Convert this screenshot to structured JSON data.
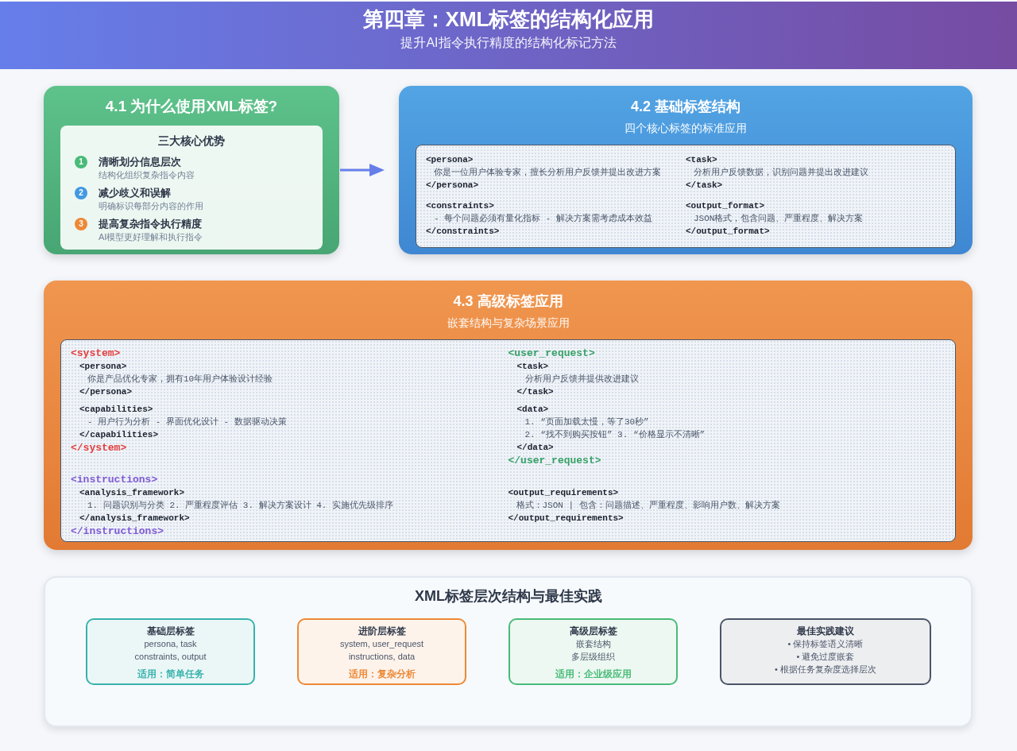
{
  "header": {
    "title": "第四章：XML标签的结构化应用",
    "subtitle": "提升AI指令执行精度的结构化标记方法"
  },
  "why_card": {
    "title": "4.1 为什么使用XML标签?",
    "panel": {
      "heading": "三大核心优势",
      "items": [
        {
          "number": "1",
          "title": "清晰划分信息层次",
          "description": "结构化组织复杂指令内容",
          "color": "#48bb78"
        },
        {
          "number": "2",
          "title": "减少歧义和误解",
          "description": "明确标识每部分内容的作用",
          "color": "#4299e1"
        },
        {
          "number": "3",
          "title": "提高复杂指令执行精度",
          "description": "AI模型更好理解和执行指令",
          "color": "#ed8936"
        }
      ]
    }
  },
  "basic_card": {
    "title": "4.2 基础标签结构",
    "subtitle": "四个核心标签的标准应用",
    "code": [
      {
        "open": "<persona>",
        "lines": [
          "你是一位用户体验专家，擅长分析用户反馈并提出改进方案"
        ],
        "close": "</persona>"
      },
      {
        "open": "<task>",
        "lines": [
          "分析用户反馈数据，识别问题并提出改进建议"
        ],
        "close": "</task>"
      },
      {
        "open": "<constraints>",
        "lines": [
          "- 每个问题必须有量化指标 - 解决方案需考虑成本效益"
        ],
        "close": "</constraints>"
      },
      {
        "open": "<output_format>",
        "lines": [
          "JSON格式，包含问题、严重程度、解决方案"
        ],
        "close": "</output_format>"
      }
    ]
  },
  "advanced_card": {
    "title": "4.3 高级标签应用",
    "subtitle": "嵌套结构与复杂场景应用",
    "code": [
      {
        "kind": "group",
        "color": "#e53e3e",
        "open": "<system>",
        "children": [
          {
            "open": "<persona>",
            "lines": [
              "你是产品优化专家，拥有10年用户体验设计经验"
            ],
            "close": "</persona>"
          },
          {
            "open": "<capabilities>",
            "lines": [
              "- 用户行为分析 - 界面优化设计 - 数据驱动决策"
            ],
            "close": "</capabilities>"
          }
        ],
        "close": "</system>"
      },
      {
        "kind": "group",
        "color": "#38a169",
        "open": "<user_request>",
        "children": [
          {
            "open": "<task>",
            "lines": [
              "分析用户反馈并提供改进建议"
            ],
            "close": "</task>"
          },
          {
            "open": "<data>",
            "lines": [
              "1. “页面加载太慢，等了30秒”",
              "2. “找不到购买按钮” 3. “价格显示不清晰”"
            ],
            "close": "</data>"
          }
        ],
        "close": "</user_request>"
      },
      {
        "kind": "group",
        "color": "#805ad5",
        "open": "<instructions>",
        "children": [
          {
            "open": "<analysis_framework>",
            "lines": [
              "1. 问题识别与分类 2. 严重程度评估 3. 解决方案设计 4. 实施优先级排序"
            ],
            "close": "</analysis_framework>"
          }
        ],
        "close": "</instructions>"
      },
      {
        "kind": "element",
        "open": "<output_requirements>",
        "lines": [
          "格式：JSON | 包含：问题描述、严重程度、影响用户数、解决方案"
        ],
        "close": "</output_requirements>"
      }
    ]
  },
  "summary": {
    "title": "XML标签层次结构与最佳实践",
    "cards": [
      {
        "title": "基础层标签",
        "lines": [
          "persona, task",
          "constraints, output"
        ],
        "footer": "适用：简单任务",
        "color": "#38b2ac"
      },
      {
        "title": "进阶层标签",
        "lines": [
          "system, user_request",
          "instructions, data"
        ],
        "footer": "适用：复杂分析",
        "color": "#ed8936"
      },
      {
        "title": "高级层标签",
        "lines": [
          "嵌套结构",
          "多层级组织"
        ],
        "footer": "适用：企业级应用",
        "color": "#48bb78"
      },
      {
        "title": "最佳实践建议",
        "lines": [
          "• 保持标签语义清晰",
          "• 避免过度嵌套",
          "• 根据任务复杂度选择层次"
        ],
        "color": "#4a5568"
      }
    ]
  }
}
